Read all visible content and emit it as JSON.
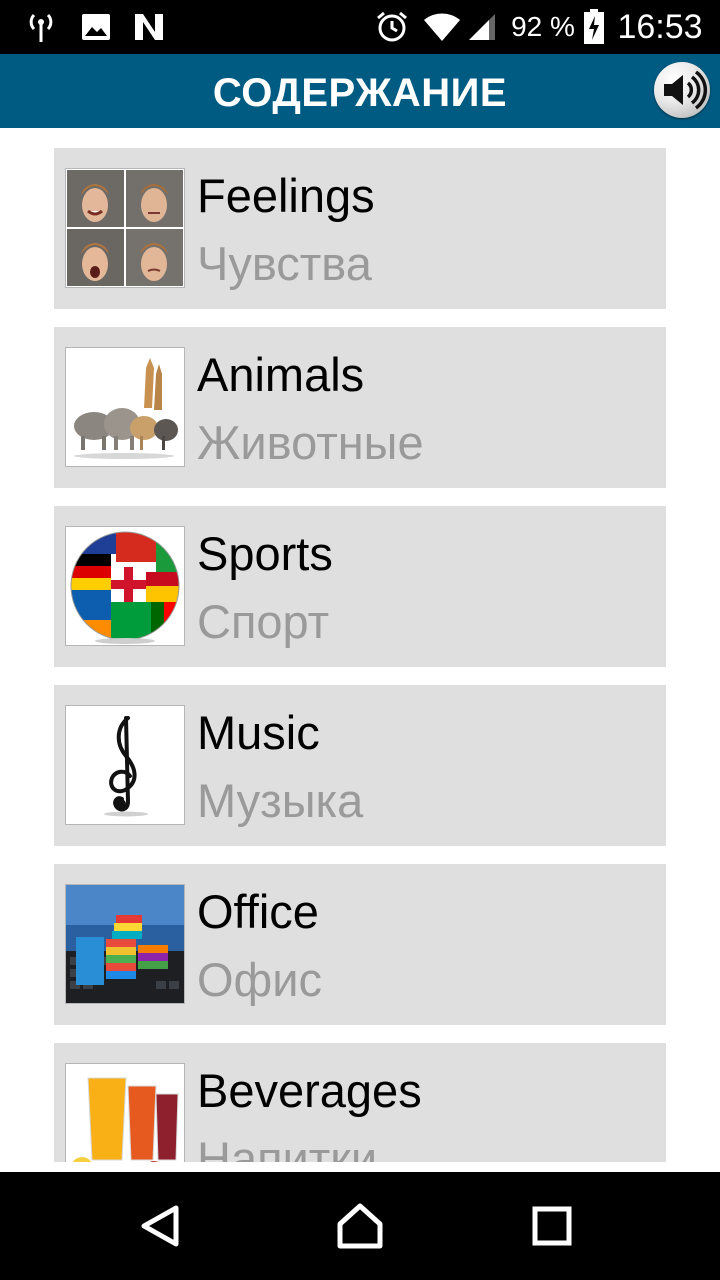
{
  "status_bar": {
    "battery_percent": "92 %",
    "time": "16:53",
    "icons": [
      "radio-tower-icon",
      "image-icon",
      "n-app-icon",
      "alarm-icon",
      "wifi-icon",
      "signal-icon",
      "battery-charging-icon"
    ]
  },
  "app_bar": {
    "title": "СОДЕРЖАНИЕ",
    "speaker_icon": "speaker-icon",
    "background_color": "#005b82"
  },
  "categories": [
    {
      "en": "Feelings",
      "ru": "Чувства",
      "image": "faces-grid"
    },
    {
      "en": "Animals",
      "ru": "Животные",
      "image": "animals-group"
    },
    {
      "en": "Sports",
      "ru": "Спорт",
      "image": "flag-ball"
    },
    {
      "en": "Music",
      "ru": "Музыка",
      "image": "treble-clef"
    },
    {
      "en": "Office",
      "ru": "Офис",
      "image": "binders-keyboard"
    },
    {
      "en": "Beverages",
      "ru": "Напитки",
      "image": "juice-glasses"
    }
  ],
  "nav_bar": {
    "icons": [
      "back-icon",
      "home-icon",
      "recents-icon"
    ]
  }
}
